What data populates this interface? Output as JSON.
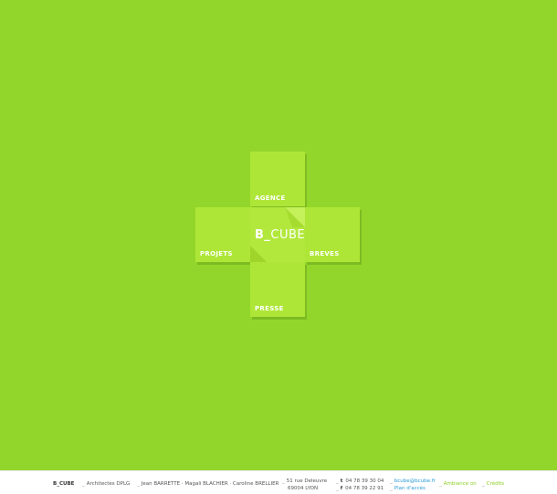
{
  "nav": {
    "agence": "AGENCE",
    "projets": "PROJETS",
    "breves": "BREVES",
    "presse": "PRESSE",
    "logo_prefix": "B_",
    "logo_suffix": "CUBE"
  },
  "footer": {
    "brand": "B_CUBE",
    "dash": "_",
    "architects": "Architectes DPLG",
    "partners": "Jean BARRETTE · Magali BLACHIER · Caroline BRELLIER",
    "address_line1": "51 rue Deleuvre",
    "address_line2": "69004 LYON",
    "tel_icon": "t",
    "tel": "04 78 39 30 04",
    "fax_icon": "f",
    "fax": "04 78 39 22 91",
    "email": "bcube@bcube.fr",
    "plan": "Plan d'accès",
    "ambiance": "Ambiance on",
    "credits": "Crédits"
  },
  "colors": {
    "background": "#93d62b",
    "tile": "#aee637",
    "link": "#2b9bd6",
    "accent_link": "#8ccf22"
  }
}
